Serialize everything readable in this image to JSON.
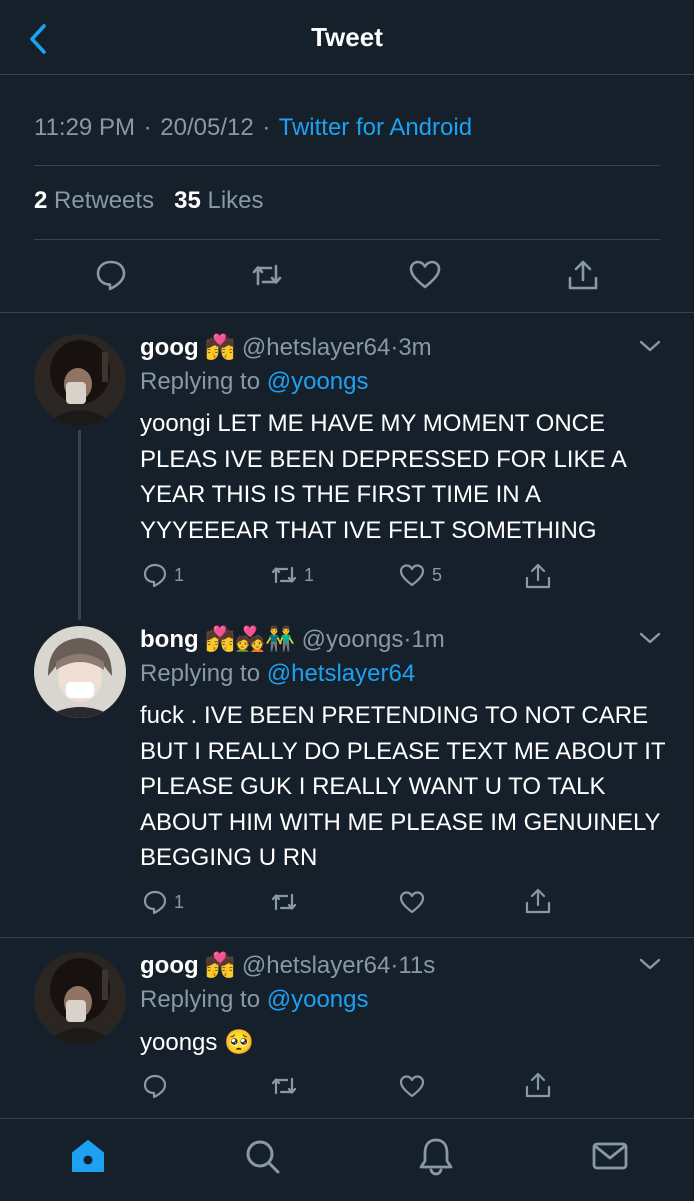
{
  "header": {
    "title": "Tweet"
  },
  "tweet_meta": {
    "time": "11:29 PM",
    "date": "20/05/12",
    "client": "Twitter for Android",
    "retweets_count": "2",
    "retweets_label": "Retweets",
    "likes_count": "35",
    "likes_label": "Likes"
  },
  "replies": [
    {
      "name": "goog",
      "emoji": "💏",
      "handle": "@hetslayer64",
      "time": "3m",
      "replying_label": "Replying to",
      "replying_to": "@yoongs",
      "text": "yoongi LET ME HAVE MY MOMENT ONCE PLEAS IVE BEEN DEPRESSED FOR LIKE A YEAR THIS IS THE FIRST TIME IN A YYYEEEAR THAT IVE FELT SOMETHING",
      "reply_count": "1",
      "retweet_count": "1",
      "like_count": "5"
    },
    {
      "name": "bong",
      "emoji": "💏💑👬",
      "handle": "@yoongs",
      "time": "1m",
      "replying_label": "Replying to",
      "replying_to": "@hetslayer64",
      "text": "fuck . IVE BEEN PRETENDING TO NOT CARE BUT I REALLY DO PLEASE TEXT ME ABOUT IT PLEASE GUK I REALLY WANT U TO TALK ABOUT HIM WITH ME PLEASE IM GENUINELY BEGGING U RN",
      "reply_count": "1",
      "retweet_count": "",
      "like_count": ""
    },
    {
      "name": "goog",
      "emoji": "💏",
      "handle": "@hetslayer64",
      "time": "11s",
      "replying_label": "Replying to",
      "replying_to": "@yoongs",
      "text": "yoongs 🥺",
      "reply_count": "",
      "retweet_count": "",
      "like_count": ""
    }
  ],
  "colors": {
    "background": "#15202b",
    "accent": "#1da1f2",
    "muted": "#8899a6",
    "divider": "#38444d"
  },
  "icons": {
    "back": "chevron-left-icon",
    "reply": "speech-bubble-icon",
    "retweet": "retweet-icon",
    "like": "heart-icon",
    "share": "share-icon",
    "menu": "chevron-down-icon",
    "tab_home": "home-icon",
    "tab_search": "search-icon",
    "tab_notifications": "bell-icon",
    "tab_messages": "envelope-icon"
  }
}
